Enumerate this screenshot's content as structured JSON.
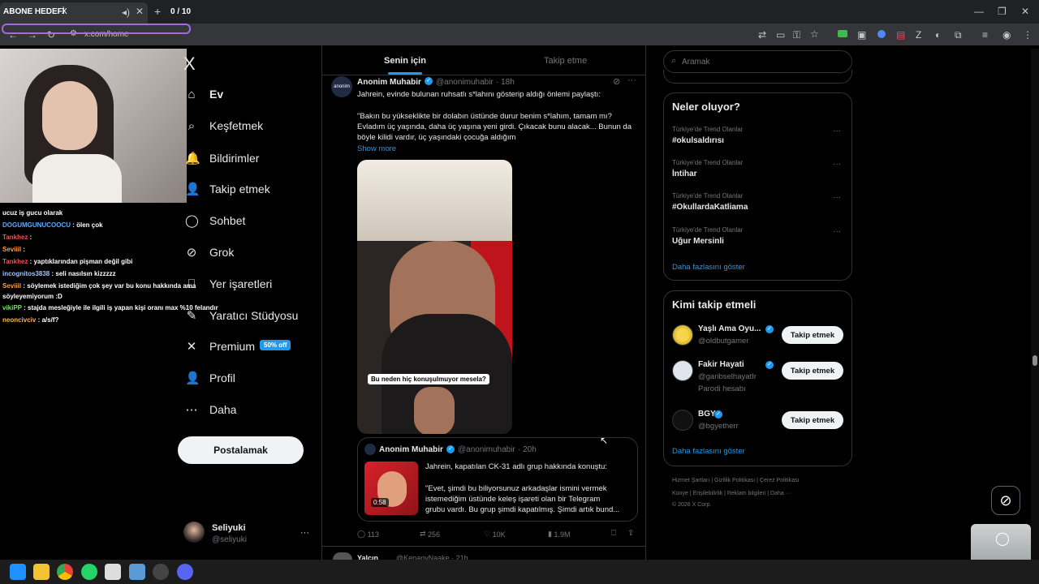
{
  "browser": {
    "tab_title": "ABONE HEDEFİ",
    "tab_close": "X",
    "counter": "0 / 10",
    "url": "x.com/home"
  },
  "stream": {
    "chat": [
      {
        "user": "",
        "text": "ucuz iş gucu olarak",
        "color": "#ffffff"
      },
      {
        "user": "DOGUMGUNUCOOCU",
        "text": ": ölen çok",
        "color": "#5aa9ff"
      },
      {
        "user": "Tankhez",
        "text": ":",
        "color": "#ff4d4d"
      },
      {
        "user": "Seviiil",
        "text": ":",
        "color": "#ff9f43"
      },
      {
        "user": "Tankhez",
        "text": ": yaptıklarından pişman değil gibi",
        "color": "#ff4d4d"
      },
      {
        "user": "incognitos3838",
        "text": ": seli nasılsın kizzzzz",
        "color": "#9ec3ff"
      },
      {
        "user": "Seviiil",
        "text": ": söylemek istediğim çok şey var bu konu hakkında ama",
        "color": "#ff9f43"
      },
      {
        "user": "",
        "text": "söyleyemiyorum :D",
        "color": "#ffffff"
      },
      {
        "user": "vikiPP",
        "text": ": stajda mesleğiyle ile ilgili iş yapan kişi oranı max %10 felandır",
        "color": "#7ddc6b"
      },
      {
        "user": "neoncivciv",
        "text": ": a/s/f?",
        "color": "#ffb347"
      }
    ]
  },
  "nav": {
    "logo": "X",
    "items": [
      {
        "label": "Ev",
        "icon": "home-icon",
        "glyph": "⌂"
      },
      {
        "label": "Keşfetmek",
        "icon": "search-icon",
        "glyph": "⌕"
      },
      {
        "label": "Bildirimler",
        "icon": "bell-icon",
        "glyph": "🔔"
      },
      {
        "label": "Takip etmek",
        "icon": "follow-icon",
        "glyph": "👤"
      },
      {
        "label": "Sohbet",
        "icon": "chat-icon",
        "glyph": "◯"
      },
      {
        "label": "Grok",
        "icon": "grok-icon",
        "glyph": "⊘"
      },
      {
        "label": "Yer işaretleri",
        "icon": "bookmark-icon",
        "glyph": "⎕"
      },
      {
        "label": "Yaratıcı Stüdyosu",
        "icon": "studio-icon",
        "glyph": "✎"
      },
      {
        "label": "Premium",
        "icon": "premium-x-icon",
        "glyph": "✕"
      },
      {
        "label": "Profil",
        "icon": "profile-icon",
        "glyph": "👤"
      },
      {
        "label": "Daha",
        "icon": "more-icon",
        "glyph": "⋯"
      }
    ],
    "premium_badge": "50% off",
    "post_button": "Postalamak",
    "account": {
      "name": "Seliyuki",
      "handle": "@seliyuki",
      "more": "···"
    }
  },
  "tabs": {
    "for_you": "Senin için",
    "following": "Takip etme"
  },
  "tweet": {
    "author": "Anonim Muhabir",
    "handle": "@anonimuhabir",
    "time": "· 18h",
    "text1": "Jahrein, evinde bulunan ruhsatlı s*lahını gösterip aldığı önlemi paylaştı:",
    "text2": "\"Bakın bu yükseklikte bir dolabın üstünde durur benim s*lahım, tamam mı?",
    "text3": "Evladım üç yaşında, daha üç yaşına yeni girdi. Çıkacak bunu alacak... Bunun da",
    "text4": "böyle kilidi vardır, üç yaşındaki çocuğa aldığım",
    "show_more": "Show more",
    "video_caption": "Bu neden hiç konuşulmuyor mesela?",
    "quote": {
      "author": "Anonim Muhabir",
      "handle": "@anonimuhabir",
      "time": "· 20h",
      "text1": "Jahrein, kapatılan CK-31 adlı grup hakkında konuştu:",
      "text2": "\"Evet, şimdi bu biliyorsunuz arkadaşlar ismini vermek",
      "text3": "istemediğim üstünde keleş işareti olan bir Telegram",
      "text4": "grubu vardı. Bu grup şimdi kapatılmış. Şimdi artık bund...",
      "duration": "0:58"
    },
    "stats": {
      "replies": "113",
      "reposts": "256",
      "likes": "10K",
      "views": "1.9M"
    },
    "next_author": "Yalçın",
    "next_handle": "@KenanyNaake · 21h"
  },
  "right": {
    "search_placeholder": "Aramak",
    "trends_title": "Neler oluyor?",
    "trends": [
      {
        "cat": "Türkiye'de Trend Olanlar",
        "name": "#okulsaldırısı"
      },
      {
        "cat": "Türkiye'de Trend Olanlar",
        "name": "İntihar"
      },
      {
        "cat": "Türkiye'de Trend Olanlar",
        "name": "#OkullardaKatliama"
      },
      {
        "cat": "Türkiye'de Trend Olanlar",
        "name": "Uğur Mersinli"
      }
    ],
    "trends_more": "Daha fazlasını göster",
    "who_title": "Kimi takip etmeli",
    "who": [
      {
        "name": "Yaşlı Ama Oyu...",
        "handle": "@oldbutgamer",
        "note": "",
        "btn": "Takip etmek"
      },
      {
        "name": "Fakir Hayati",
        "handle": "@garibselhayatIr",
        "note": "Parodi hesabı",
        "btn": "Takip etmek"
      },
      {
        "name": "BGY",
        "handle": "@bgyetherr",
        "note": "",
        "btn": "Takip etmek"
      }
    ],
    "who_more": "Daha fazlasını göster",
    "footer1": [
      "Hizmet Şartları",
      "Gizlilik Politikası",
      "Çerez Politikası"
    ],
    "footer2": [
      "Künye",
      "Erişilebilirlik",
      "Reklam bilgileri",
      "Daha ···"
    ],
    "copyright": "© 2026 X Corp."
  }
}
